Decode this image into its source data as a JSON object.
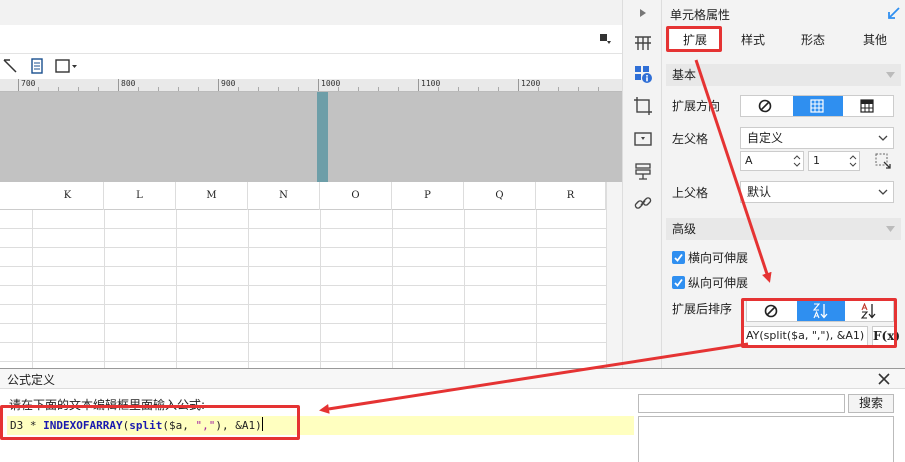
{
  "ruler": {
    "labels": [
      "700",
      "800",
      "900",
      "1000",
      "1100",
      "1200",
      "1300"
    ]
  },
  "grid": {
    "columns": [
      "K",
      "L",
      "M",
      "N",
      "O",
      "P",
      "Q",
      "R"
    ]
  },
  "props": {
    "title": "单元格属性",
    "tabs": [
      "扩展",
      "样式",
      "形态",
      "其他"
    ],
    "basic_section": "基本",
    "expand_direction_label": "扩展方向",
    "left_parent_label": "左父格",
    "left_parent_value": "自定义",
    "left_parent_col": "A",
    "left_parent_row": "1",
    "upper_parent_label": "上父格",
    "upper_parent_value": "默认",
    "advanced_section": "高级",
    "horizontal_expand": "横向可伸展",
    "vertical_expand": "纵向可伸展",
    "sort_label": "扩展后排序",
    "formula_preview": "AY(split($a, \",\"), &A1)",
    "fx_label": "F(x)"
  },
  "dialog": {
    "title": "公式定义",
    "hint": "请在下面的文本编辑框里面输入公式:",
    "formula": {
      "p1": "D3 * ",
      "p2": "INDEXOFARRAY",
      "p3": "(",
      "p4": "split",
      "p5": "($a, ",
      "p6": "\",\"",
      "p7": "), &A1)"
    },
    "search_button": "搜索"
  },
  "colors": {
    "accent": "#2f8ff0",
    "annotation": "#e53333",
    "marker": "#6d9ea8"
  }
}
